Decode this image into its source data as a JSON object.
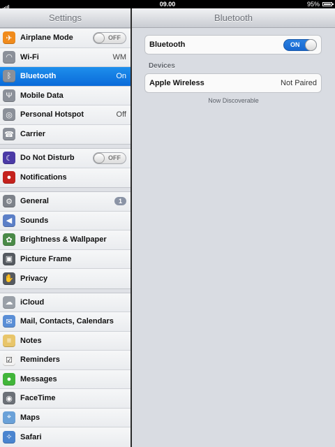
{
  "status": {
    "time": "09.00",
    "battery": "95%"
  },
  "master": {
    "title": "Settings",
    "groups": [
      [
        {
          "label": "Airplane Mode",
          "icon": "airplane-icon",
          "color": "#f08b1c",
          "switch": "OFF"
        },
        {
          "label": "Wi-Fi",
          "icon": "wifi-icon",
          "color": "#8b9099",
          "value": "WM"
        },
        {
          "label": "Bluetooth",
          "icon": "bluetooth-icon",
          "color": "#8b9099",
          "value": "On",
          "selected": true
        },
        {
          "label": "Mobile Data",
          "icon": "antenna-icon",
          "color": "#8b9099"
        },
        {
          "label": "Personal Hotspot",
          "icon": "hotspot-icon",
          "color": "#8b9099",
          "value": "Off"
        },
        {
          "label": "Carrier",
          "icon": "phone-icon",
          "color": "#8b9099"
        }
      ],
      [
        {
          "label": "Do Not Disturb",
          "icon": "moon-icon",
          "color": "#4b3aa6",
          "switch": "OFF"
        },
        {
          "label": "Notifications",
          "icon": "notifications-icon",
          "color": "#c4221d"
        }
      ],
      [
        {
          "label": "General",
          "icon": "gear-icon",
          "color": "#7d828a",
          "badge": "1"
        },
        {
          "label": "Sounds",
          "icon": "speaker-icon",
          "color": "#5b7fc7"
        },
        {
          "label": "Brightness & Wallpaper",
          "icon": "flower-icon",
          "color": "#4a8a48"
        },
        {
          "label": "Picture Frame",
          "icon": "picture-frame-icon",
          "color": "#555a60"
        },
        {
          "label": "Privacy",
          "icon": "hand-icon",
          "color": "#555a60"
        }
      ],
      [
        {
          "label": "iCloud",
          "icon": "cloud-icon",
          "color": "#9aa0a8"
        },
        {
          "label": "Mail, Contacts, Calendars",
          "icon": "mail-icon",
          "color": "#5a8ed6"
        },
        {
          "label": "Notes",
          "icon": "notes-icon",
          "color": "#e8c56a"
        },
        {
          "label": "Reminders",
          "icon": "reminders-icon",
          "color": "#f2f2f2"
        },
        {
          "label": "Messages",
          "icon": "messages-icon",
          "color": "#41b53a"
        },
        {
          "label": "FaceTime",
          "icon": "facetime-icon",
          "color": "#6c7178"
        },
        {
          "label": "Maps",
          "icon": "maps-icon",
          "color": "#6aa1d8"
        },
        {
          "label": "Safari",
          "icon": "safari-icon",
          "color": "#4a84cf"
        }
      ]
    ]
  },
  "detail": {
    "title": "Bluetooth",
    "bluetooth_label": "Bluetooth",
    "bluetooth_switch": "ON",
    "devices_header": "Devices",
    "device_name": "Apple Wireless",
    "device_status": "Not Paired",
    "discoverable_text": "Now Discoverable"
  }
}
